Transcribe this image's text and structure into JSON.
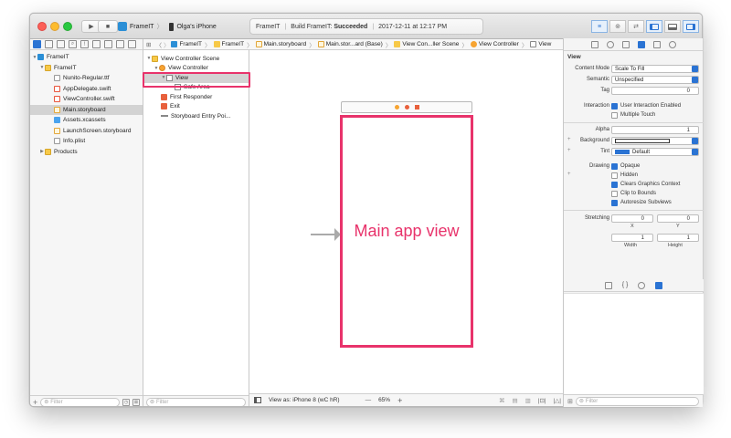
{
  "colors": {
    "highlight": "#e8336b",
    "accent": "#2a73d3"
  },
  "toolbar": {
    "scheme_target": "FrameIT",
    "scheme_device": "Olga's iPhone",
    "activity_project": "FrameIT",
    "activity_status_prefix": "Build FrameIT: ",
    "activity_status": "Succeeded",
    "activity_time": "2017-12-11 at 12:17 PM"
  },
  "navigator": {
    "items": [
      {
        "label": "FrameIT",
        "icon": "project-icon",
        "selected": false
      },
      {
        "label": "FrameIT",
        "icon": "folder-icon",
        "selected": false
      },
      {
        "label": "Nunito-Regular.ttf",
        "icon": "file-icon",
        "selected": false
      },
      {
        "label": "AppDelegate.swift",
        "icon": "swift-file-icon",
        "selected": false
      },
      {
        "label": "ViewController.swift",
        "icon": "swift-file-icon",
        "selected": false
      },
      {
        "label": "Main.storyboard",
        "icon": "storyboard-icon",
        "selected": true
      },
      {
        "label": "Assets.xcassets",
        "icon": "assets-icon",
        "selected": false
      },
      {
        "label": "LaunchScreen.storyboard",
        "icon": "storyboard-icon",
        "selected": false
      },
      {
        "label": "Info.plist",
        "icon": "file-icon",
        "selected": false
      },
      {
        "label": "Products",
        "icon": "folder-icon",
        "selected": false
      }
    ],
    "filter_placeholder": "Filter"
  },
  "jumpbar": {
    "crumbs": [
      "FrameIT",
      "FrameIT",
      "Main.storyboard",
      "Main.stor...ard (Base)",
      "View Con...ller Scene",
      "View Controller",
      "View"
    ]
  },
  "outline": {
    "items": [
      {
        "label": "View Controller Scene",
        "icon": "scene-icon"
      },
      {
        "label": "View Controller",
        "icon": "view-controller-icon"
      },
      {
        "label": "View",
        "icon": "view-icon"
      },
      {
        "label": "Safe Area",
        "icon": "view-icon"
      },
      {
        "label": "First Responder",
        "icon": "first-responder-icon"
      },
      {
        "label": "Exit",
        "icon": "exit-icon"
      },
      {
        "label": "Storyboard Entry Poi...",
        "icon": "entry-point-icon"
      }
    ],
    "filter_placeholder": "Filter"
  },
  "canvas": {
    "annotation": "Main app view",
    "view_as": "View as: iPhone 8 (wC hR)",
    "zoom_minus": "—",
    "zoom": "65%",
    "zoom_plus": "+"
  },
  "inspector": {
    "section_title": "View",
    "content_mode_label": "Content Mode",
    "content_mode_value": "Scale To Fill",
    "semantic_label": "Semantic",
    "semantic_value": "Unspecified",
    "tag_label": "Tag",
    "tag_value": "0",
    "interaction_label": "Interaction",
    "user_interaction": "User Interaction Enabled",
    "multiple_touch": "Multiple Touch",
    "alpha_label": "Alpha",
    "alpha_value": "1",
    "background_label": "Background",
    "tint_label": "Tint",
    "tint_value": "Default",
    "drawing_label": "Drawing",
    "opaque": "Opaque",
    "hidden": "Hidden",
    "clears_context": "Clears Graphics Context",
    "clip_to_bounds": "Clip to Bounds",
    "autoresize": "Autoresize Subviews",
    "stretching_label": "Stretching",
    "stretch_x_value": "0",
    "stretch_y_value": "0",
    "stretch_w_value": "1",
    "stretch_h_value": "1",
    "x_label": "X",
    "y_label": "Y",
    "width_label": "Width",
    "height_label": "Height",
    "filter_placeholder": "Filter"
  }
}
